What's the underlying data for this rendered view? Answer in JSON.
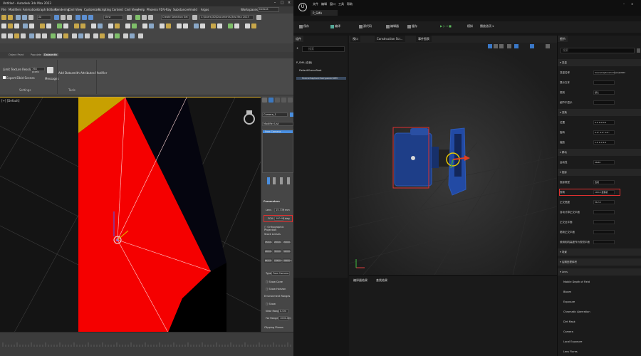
{
  "max": {
    "title": "Untitled - Autodesk 3ds Max 2023",
    "menu": [
      "File",
      "Edit",
      "Tools",
      "Group",
      "Views",
      "Create",
      "Modifiers",
      "Animation",
      "Graph Editors",
      "Rendering",
      "Civil View",
      "Customize",
      "Scripting",
      "Content",
      "Civil View",
      "Help",
      "Phoenix FD",
      "V-Ray",
      "Substance",
      "Arnold",
      "Argos"
    ],
    "workspace_label": "Workspaces:",
    "workspace_value": "Default",
    "selection_set": "Create Selection Set",
    "view_combo": "View",
    "path_combo": "C:\\Users\\3D\\Documents\\3ds Max 2023",
    "ribbon_tabs": [
      "Object Paint",
      "Populate",
      "Datasmith"
    ],
    "ribbon": {
      "limit_label": "Limit Texture Resolution",
      "limit_value": "768 pixels",
      "export_label": "Export Elbid Scenes",
      "messages_label": "Messages",
      "modifier_label": "Add Datasmith Attributes Modifier",
      "group_settings": "Settings",
      "group_tools": "Tools"
    },
    "viewport_label": "[+] [Default]",
    "cmd": {
      "object_name": "Camera_1",
      "modifier_list": "Modifier List",
      "stack_item": "Free Camera",
      "params_header": "Parameters",
      "lens_label": "Lens",
      "lens_value": "15.339",
      "lens_unit": "mm",
      "fov_label": "FOV:",
      "fov_value": "100.00",
      "fov_unit": "deg",
      "ortho": "Orthographic Projection",
      "stock_header": "Stock Lenses",
      "stock_lenses": [
        "15mm",
        "20mm",
        "24mm",
        "28mm",
        "35mm",
        "50mm",
        "85mm",
        "135mm",
        "200mm"
      ],
      "type_label": "Type",
      "type_value": "Free Camera",
      "show_cone": "Show Cone",
      "show_horizon": "Show Horizon",
      "env_header": "Environment Ranges",
      "show": "Show",
      "near_range": "Near Range",
      "near_value": "0.0m",
      "far_range": "Far Range",
      "far_value": "1000.0m",
      "clipping_header": "Clipping Planes"
    }
  },
  "ue": {
    "menu": [
      "文件",
      "编辑",
      "窗口",
      "工具",
      "帮助"
    ],
    "tab_title": "P_SMA",
    "toolbar": [
      "保存",
      "编译",
      "源代码",
      "编辑器",
      "缓存",
      "模拟",
      "播放选项"
    ],
    "comp_tab": "组件",
    "add_btn": "+ 添加",
    "comp_search_placeholder": "搜索",
    "comp_root": "P_SMA (自我)",
    "comp_default": "DefaultSceneRoot",
    "comp_capture": "SceneCaptureComponent2D",
    "vp_tabs": [
      "视口",
      "Construction Scr...",
      "事件图表"
    ],
    "bottom_tabs": [
      "编译器结果",
      "查找结果"
    ],
    "details": {
      "tab": "细节",
      "search": "搜索",
      "rows": [
        {
          "label": "变量",
          "kind": "head"
        },
        {
          "label": "变量名称",
          "value": "SceneCaptureComponent2D"
        },
        {
          "label": "提示文本",
          "value": ""
        },
        {
          "label": "类别",
          "value": "默认"
        },
        {
          "label": "细节中显示",
          "value": ""
        },
        {
          "label": "变换",
          "kind": "head"
        },
        {
          "label": "位置",
          "value": "0.0   0.0   0.0"
        },
        {
          "label": "旋转",
          "value": "0.0°   0.0°   0.0°"
        },
        {
          "label": "缩放",
          "value": "1.0   1.0   1.0"
        },
        {
          "label": "移动",
          "kind": "head"
        },
        {
          "label": "运动性",
          "value": "Static"
        },
        {
          "label": "投影",
          "kind": "head"
        },
        {
          "label": "投影类型",
          "value": "透视"
        },
        {
          "label": "视场",
          "value": "100.0 摄像机",
          "highlight": true
        },
        {
          "label": "正交宽度",
          "value": "512.0"
        },
        {
          "label": "自动计算正交平面",
          "value": ""
        },
        {
          "label": "正交近平面",
          "value": ""
        },
        {
          "label": "更新正交平面",
          "value": ""
        },
        {
          "label": "使用相机高度作为视觉平面",
          "value": ""
        },
        {
          "label": "场景",
          "kind": "head"
        },
        {
          "label": "后期处理体积",
          "kind": "head"
        },
        {
          "label": "Lens",
          "kind": "head"
        },
        {
          "label": "Mobile Depth of Field",
          "kind": "group"
        },
        {
          "label": "Bloom",
          "kind": "group"
        },
        {
          "label": "Exposure",
          "kind": "group"
        },
        {
          "label": "Chromatic Aberration",
          "kind": "group"
        },
        {
          "label": "Dirt Mask",
          "kind": "group"
        },
        {
          "label": "Camera",
          "kind": "group"
        },
        {
          "label": "Local Exposure",
          "kind": "group"
        },
        {
          "label": "Lens Flares",
          "kind": "group"
        }
      ]
    },
    "colors": {
      "highlight": "#e03030",
      "accent": "#2f6fb0",
      "play": "#5cb85c"
    }
  }
}
